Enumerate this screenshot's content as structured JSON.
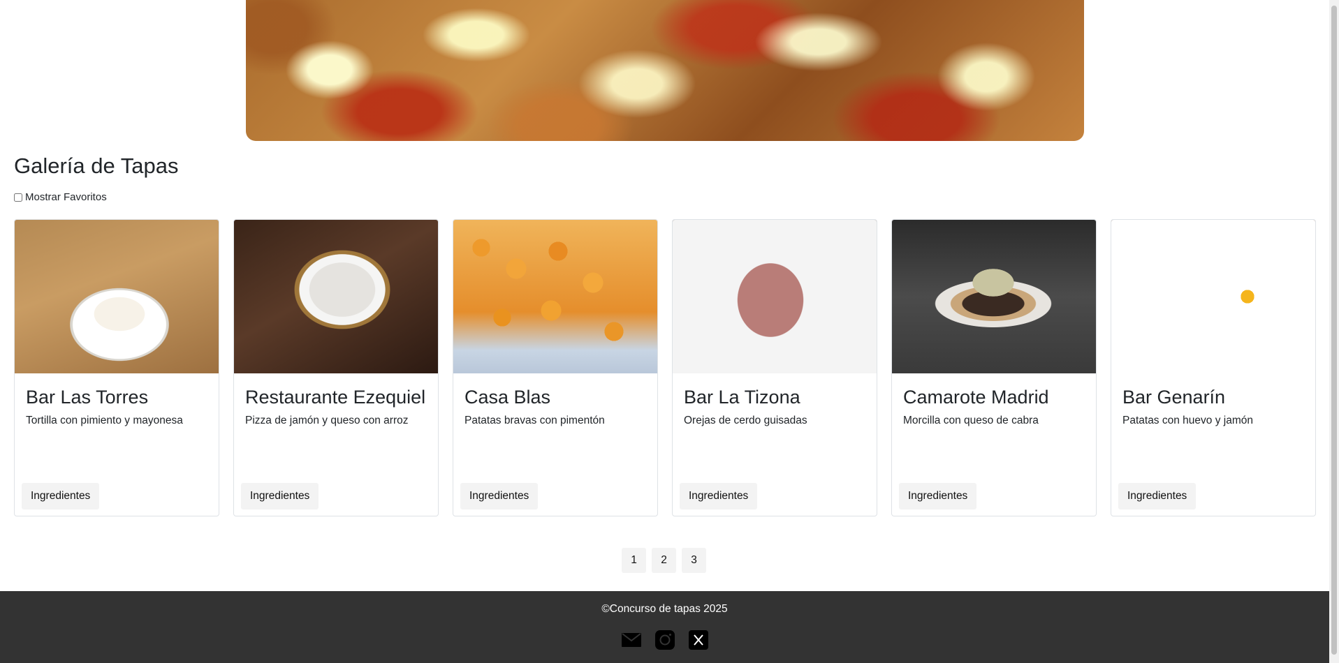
{
  "gallery": {
    "title": "Galería de Tapas",
    "favorites_label": "Mostrar Favoritos",
    "favorites_checked": false
  },
  "cards": [
    {
      "name": "Bar Las Torres",
      "description": "Tortilla con pimiento y mayonesa",
      "button": "Ingredientes"
    },
    {
      "name": "Restaurante Ezequiel",
      "description": "Pizza de jamón y queso con arroz",
      "button": "Ingredientes"
    },
    {
      "name": "Casa Blas",
      "description": "Patatas bravas con pimentón",
      "button": "Ingredientes"
    },
    {
      "name": "Bar La Tizona",
      "description": "Orejas de cerdo guisadas",
      "button": "Ingredientes"
    },
    {
      "name": "Camarote Madrid",
      "description": "Morcilla con queso de cabra",
      "button": "Ingredientes"
    },
    {
      "name": "Bar Genarín",
      "description": "Patatas con huevo y jamón",
      "button": "Ingredientes"
    }
  ],
  "pagination": [
    "1",
    "2",
    "3"
  ],
  "footer": {
    "copyright": "©Concurso de tapas 2025",
    "icons": [
      "mail-icon",
      "instagram-icon",
      "x-icon"
    ]
  },
  "colors": {
    "footer_bg": "#333333",
    "button_bg": "#f3f3f3"
  }
}
